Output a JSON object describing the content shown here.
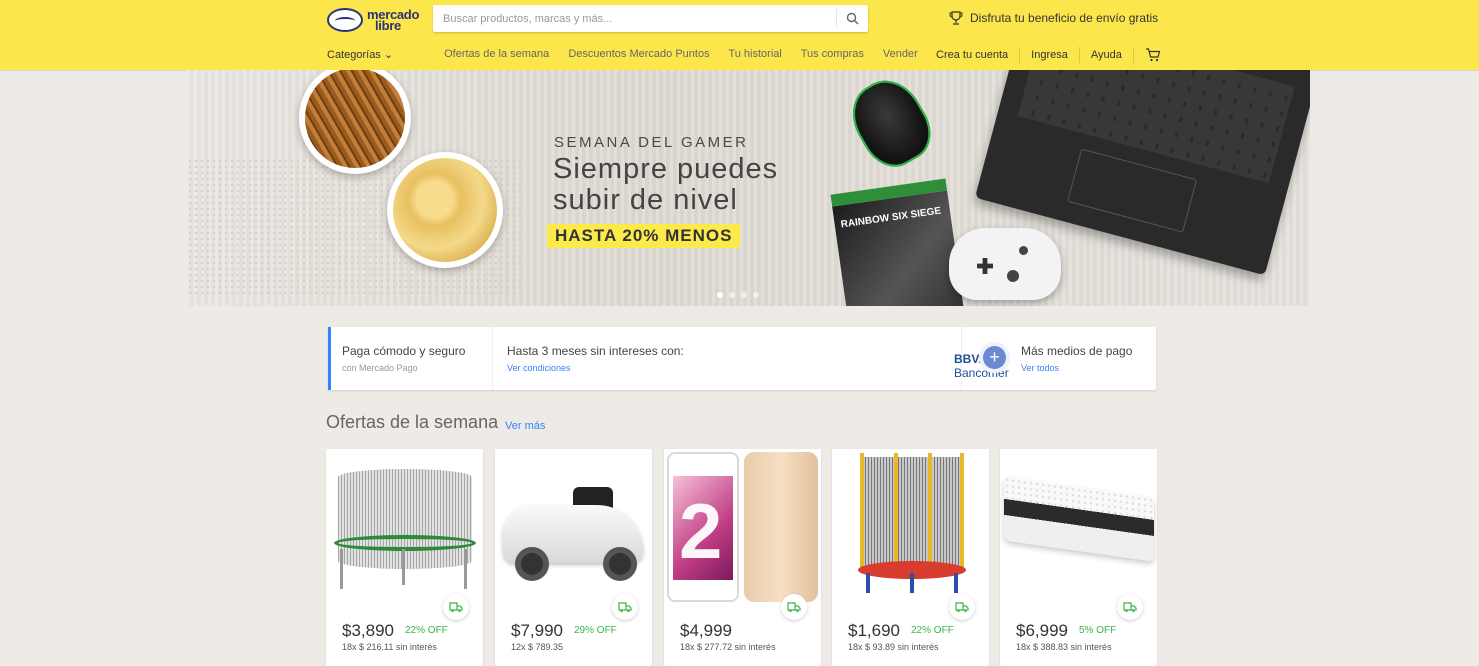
{
  "header": {
    "logo_line1": "mercado",
    "logo_line2": "libre",
    "search_placeholder": "Buscar productos, marcas y más...",
    "promo_text": "Disfruta tu beneficio de envío gratis",
    "categories_label": "Categorías ⌄",
    "nav_links": [
      "Ofertas de la semana",
      "Descuentos Mercado Puntos",
      "Tu historial",
      "Tus compras",
      "Vender"
    ],
    "account_links": [
      "Crea tu cuenta",
      "Ingresa",
      "Ayuda"
    ],
    "brand_color": "#fbe74c"
  },
  "banner": {
    "kicker": "SEMANA DEL GAMER",
    "title": "Siempre puedes subir de nivel",
    "badge": "HASTA 20% MENOS",
    "game_box_text": "RAINBOW SIX SIEGE"
  },
  "payment": {
    "s1_title": "Paga cómodo y seguro",
    "s1_sub": "con Mercado Pago",
    "s2_title": "Hasta 3 meses sin intereses con:",
    "s2_link": "Ver condiciones",
    "bank_strong": "BBVA",
    "bank_rest": " Bancomer",
    "s3_title": "Más medios de pago",
    "s3_link": "Ver todos"
  },
  "offers": {
    "title": "Ofertas de la semana",
    "more": "Ver más",
    "items": [
      {
        "name": "trampolin",
        "price": "$3,890",
        "discount": "22% OFF",
        "installments": "18x $ 216.11 sin interés"
      },
      {
        "name": "auto-electrico",
        "price": "$7,990",
        "discount": "29% OFF",
        "installments": "12x $ 789.35"
      },
      {
        "name": "celular",
        "price": "$4,999",
        "discount": "",
        "installments": "18x $ 277.72 sin interés"
      },
      {
        "name": "mini-trampolin",
        "price": "$1,690",
        "discount": "22% OFF",
        "installments": "18x $ 93.89 sin interés"
      },
      {
        "name": "colchon",
        "price": "$6,999",
        "discount": "5% OFF",
        "installments": "18x $ 388.83 sin interés"
      }
    ]
  },
  "icons": {
    "search": "search-icon",
    "promo": "trophy-icon",
    "cart": "cart-icon",
    "shipping": "truck-icon",
    "plus": "plus-icon"
  }
}
